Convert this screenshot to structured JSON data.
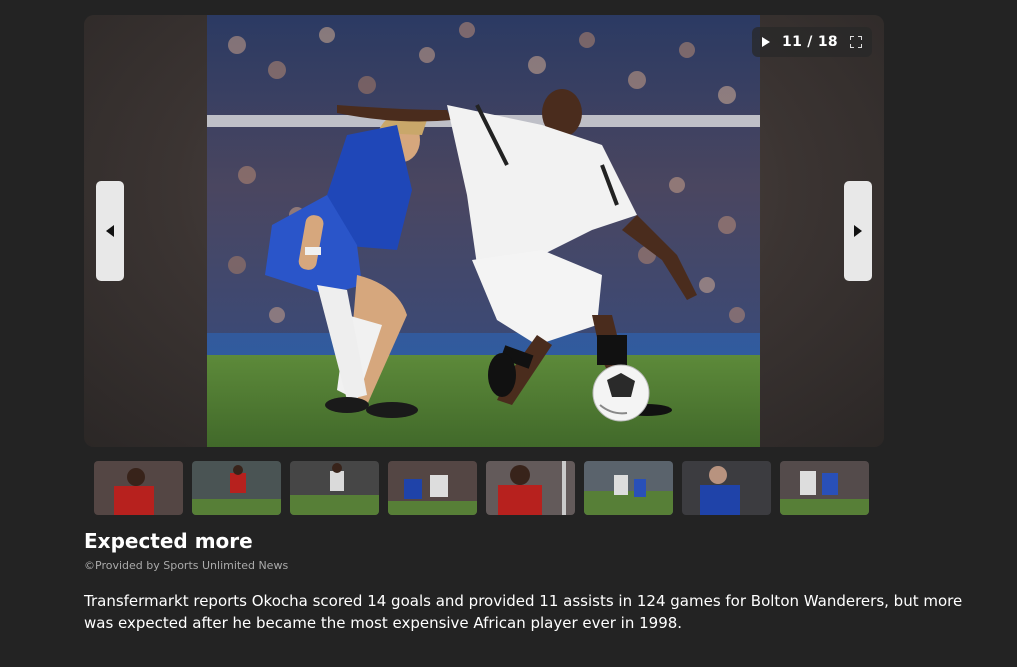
{
  "slideshow": {
    "counter": "11 / 18",
    "play_icon": "play-icon",
    "fullscreen_icon": "fullscreen-icon",
    "prev_icon": "chevron-left-icon",
    "next_icon": "chevron-right-icon",
    "photo_alt": "photo-okocha-bolton-vs-chelsea",
    "thumbnail_count": 8
  },
  "article": {
    "title": "Expected more",
    "credit": "©Provided by Sports Unlimited News",
    "body": "Transfermarkt reports Okocha scored 14 goals and provided 11 assists in 124 games for Bolton Wanderers, but more was expected after he became the most expensive African player ever in 1998."
  },
  "colors": {
    "background": "#232323",
    "pitch": "#4f7a2f",
    "chelsea_blue": "#1f47b8",
    "bolton_white": "#f2f2f2"
  }
}
